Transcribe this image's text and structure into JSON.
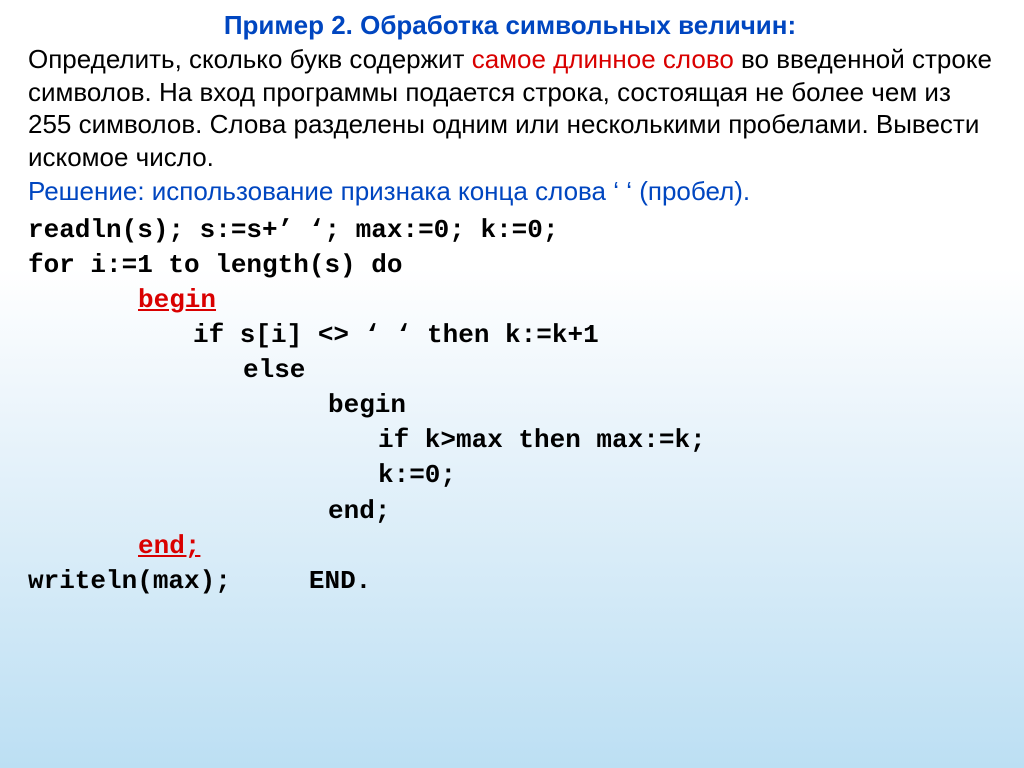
{
  "title": "Пример 2. Обработка символьных величин:",
  "intro_part1": "Определить, сколько букв содержит ",
  "intro_red": "самое длинное слово",
  "intro_part2": " во введенной строке символов. На вход программы подается строка, состоящая не более чем из 255 символов. Слова разделены одним или несколькими пробелами. Вывести искомое число.",
  "solution": "Решение: использование признака конца слова ‘ ‘ (пробел).",
  "code": {
    "l1": "readln(s);   s:=s+’ ‘; max:=0;   k:=0;",
    "l2": "for i:=1 to length(s) do",
    "l3": "begin",
    "l4": "if s[i] <> ‘ ‘ then k:=k+1",
    "l5": "else",
    "l6": "begin",
    "l7": "if k>max then max:=k;",
    "l8": "k:=0;",
    "l9": "end;",
    "l10": "end;",
    "l11a": "writeln(max);",
    "l11b": "END."
  }
}
